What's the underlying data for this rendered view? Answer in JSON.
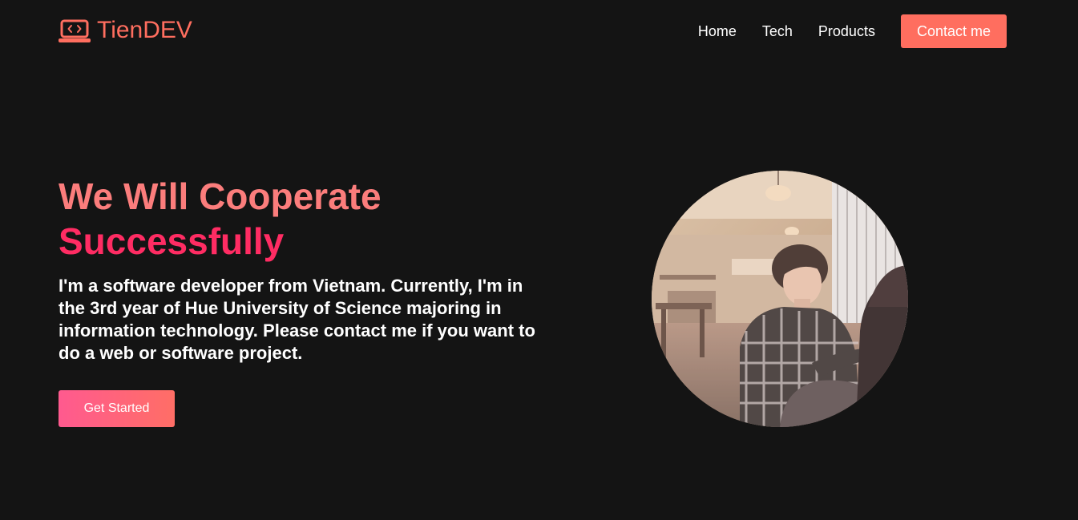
{
  "brand": {
    "name": "TienDEV",
    "icon": "laptop-code-icon",
    "color": "#ff6e5f"
  },
  "nav": {
    "items": [
      {
        "label": "Home"
      },
      {
        "label": "Tech"
      },
      {
        "label": "Products"
      }
    ],
    "contact_label": "Contact me"
  },
  "hero": {
    "title_line1": "We Will Cooperate",
    "title_line2": "Successfully",
    "description": "I'm a software developer from Vietnam. Currently, I'm in the 3rd year of Hue University of Science majoring in information technology. Please contact me if you want to do a web or software project.",
    "cta_label": "Get Started"
  },
  "colors": {
    "background": "#141414",
    "accent": "#ff6e5f",
    "title_pink": "#ff2c63"
  }
}
